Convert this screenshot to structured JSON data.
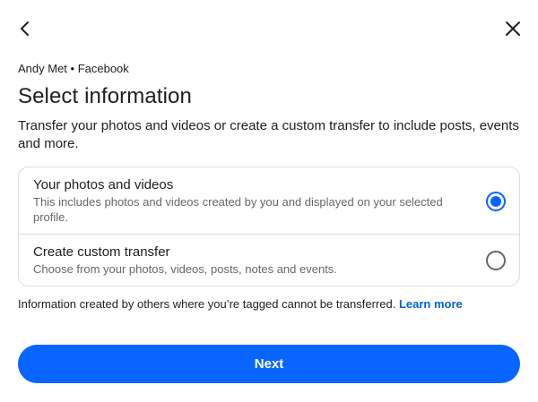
{
  "header": {
    "back_icon": "chevron-left-icon",
    "close_icon": "close-icon"
  },
  "account_label": "Andy Met • Facebook",
  "title": "Select information",
  "description": "Transfer your photos and videos or create a custom transfer to include posts, events and more.",
  "options": [
    {
      "title": "Your photos and videos",
      "subtitle": "This includes photos and videos created by you and displayed on your selected profile.",
      "selected": true
    },
    {
      "title": "Create custom transfer",
      "subtitle": "Choose from your photos, videos, posts, notes and events.",
      "selected": false
    }
  ],
  "footnote": {
    "text": "Information created by others where you’re tagged cannot be transferred.",
    "link_label": "Learn more"
  },
  "next_label": "Next",
  "colors": {
    "accent": "#0866ff",
    "link": "#0064d1",
    "secondary_text": "#65676b",
    "divider": "#dadde1"
  }
}
